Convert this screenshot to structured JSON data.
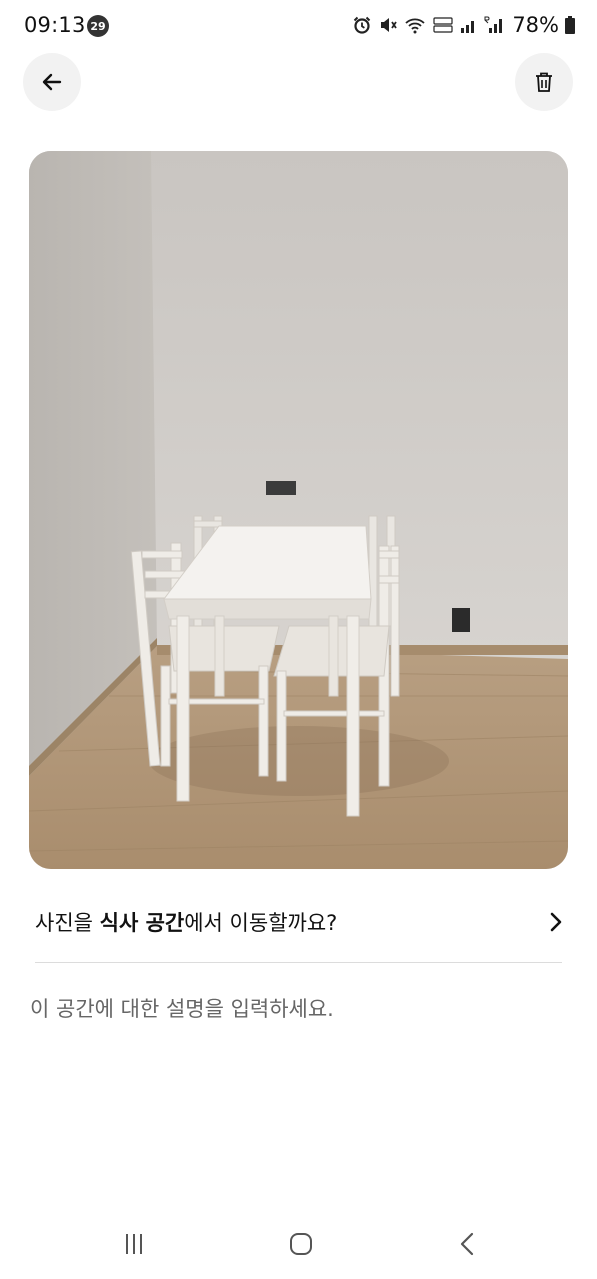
{
  "status_bar": {
    "time": "09:13",
    "notification_count": "29",
    "battery": "78%"
  },
  "top_bar": {
    "back_icon": "arrow-left-icon",
    "delete_icon": "trash-icon"
  },
  "move_prompt": {
    "prefix": "사진을 ",
    "space_name": "식사 공간",
    "suffix": "에서 이동할까요?",
    "chevron_icon": "chevron-right-icon"
  },
  "description": {
    "placeholder": "이 공간에 대한 설명을 입력하세요.",
    "value": ""
  },
  "nav_bar": {
    "recents_icon": "recents-icon",
    "home_icon": "home-icon",
    "back_icon": "back-chevron-icon"
  },
  "colors": {
    "button_background": "#f2f2f2",
    "divider": "#dcdcdc",
    "placeholder_text": "#666666"
  }
}
